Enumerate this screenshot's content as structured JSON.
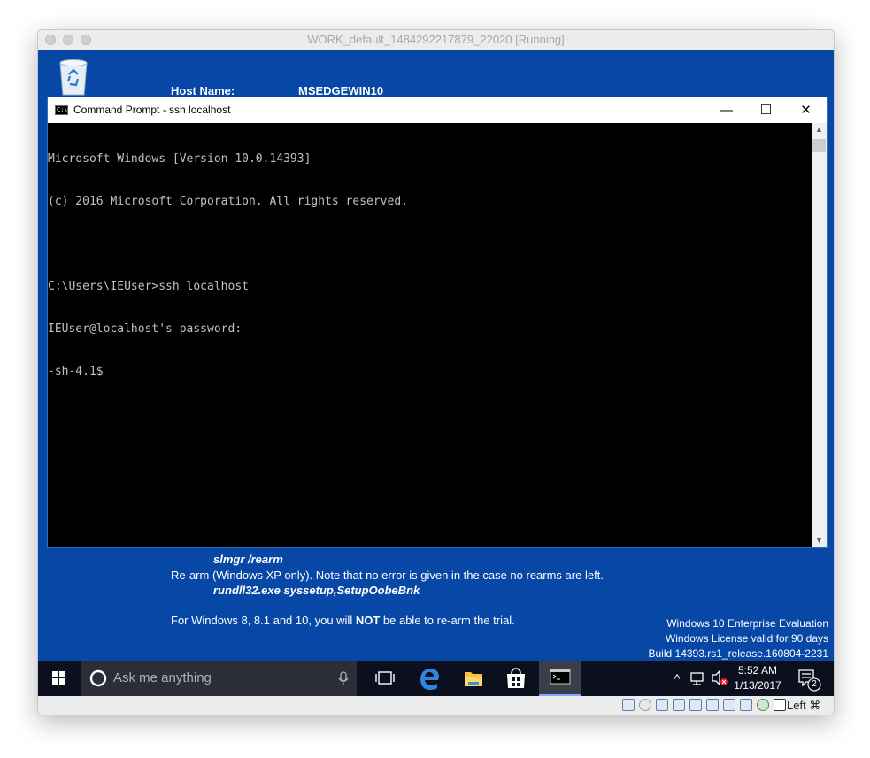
{
  "mac_window": {
    "title": "WORK_default_1484292217879_22020 [Running]"
  },
  "bginfo": {
    "host_label": "Host Name:",
    "host_value": "MSEDGEWIN10",
    "cmd_rearm": "slmgr /rearm",
    "rearm_note": "Re-arm (Windows XP only). Note that no error is given in the case no rearms are left.",
    "cmd_xp": "rundll32.exe syssetup,SetupOobeBnk",
    "win8_before": "For Windows 8, 8.1 and 10, you will ",
    "win8_not": "NOT",
    "win8_after": " be able to re-arm the trial."
  },
  "cmd_window": {
    "title": "Command Prompt - ssh  localhost",
    "minimize_glyph": "—",
    "maximize_glyph": "☐",
    "close_glyph": "✕",
    "console_lines": [
      "Microsoft Windows [Version 10.0.14393]",
      "(c) 2016 Microsoft Corporation. All rights reserved.",
      "",
      "C:\\Users\\IEUser>ssh localhost",
      "IEUser@localhost's password:",
      "-sh-4.1$"
    ]
  },
  "watermark": {
    "line1": "Windows 10 Enterprise Evaluation",
    "line2": "Windows License valid for 90 days",
    "line3": "Build 14393.rs1_release.160804-2231"
  },
  "taskbar": {
    "search_placeholder": "Ask me anything",
    "time": "5:52 AM",
    "date": "1/13/2017",
    "notification_count": "2",
    "icons": [
      "windows-start-icon",
      "cortana-icon",
      "microphone-icon",
      "task-view-icon",
      "edge-icon",
      "file-explorer-icon",
      "store-icon",
      "command-prompt-icon",
      "chevron-up-icon",
      "network-icon",
      "volume-muted-icon",
      "action-center-icon"
    ]
  },
  "vbox_status": {
    "host_key": "Left ⌘"
  },
  "colors": {
    "desktop": "#0747a6",
    "taskbar": "#0c0f1e",
    "console_bg": "#000000",
    "console_text": "#c0c0c0"
  }
}
